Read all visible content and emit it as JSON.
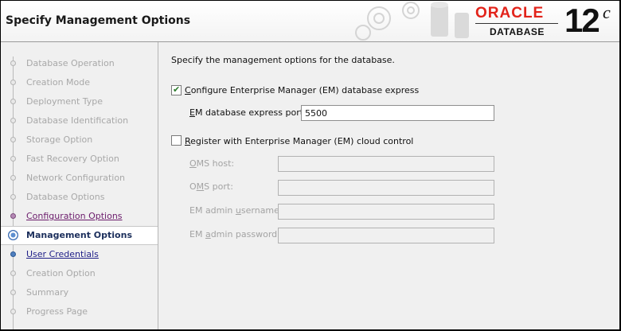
{
  "header": {
    "title": "Specify Management Options",
    "brand": {
      "oracle": "ORACLE",
      "product": "DATABASE",
      "version": "12",
      "version_suffix": "c"
    }
  },
  "sidebar": {
    "steps": [
      {
        "label": "Database Operation",
        "state": "disabled"
      },
      {
        "label": "Creation Mode",
        "state": "disabled"
      },
      {
        "label": "Deployment Type",
        "state": "disabled"
      },
      {
        "label": "Database Identification",
        "state": "disabled"
      },
      {
        "label": "Storage Option",
        "state": "disabled"
      },
      {
        "label": "Fast Recovery Option",
        "state": "disabled"
      },
      {
        "label": "Network Configuration",
        "state": "disabled"
      },
      {
        "label": "Database Options",
        "state": "disabled"
      },
      {
        "label": "Configuration Options",
        "state": "visited"
      },
      {
        "label": "Management Options",
        "state": "current"
      },
      {
        "label": "User Credentials",
        "state": "link"
      },
      {
        "label": "Creation Option",
        "state": "disabled"
      },
      {
        "label": "Summary",
        "state": "disabled"
      },
      {
        "label": "Progress Page",
        "state": "disabled"
      }
    ]
  },
  "main": {
    "description": "Specify the management options for the database.",
    "em_express": {
      "checked": true,
      "label": "Configure Enterprise Manager (EM) database express",
      "port_label": "EM database express port:",
      "port_value": "5500"
    },
    "cloud_control": {
      "checked": false,
      "label": "Register with Enterprise Manager (EM) cloud control",
      "oms_host_label": "OMS host:",
      "oms_host_value": "",
      "oms_port_label": "OMS port:",
      "oms_port_value": "",
      "admin_user_label": "EM admin username:",
      "admin_user_value": "",
      "admin_password_label": "EM admin password:",
      "admin_password_value": ""
    }
  }
}
